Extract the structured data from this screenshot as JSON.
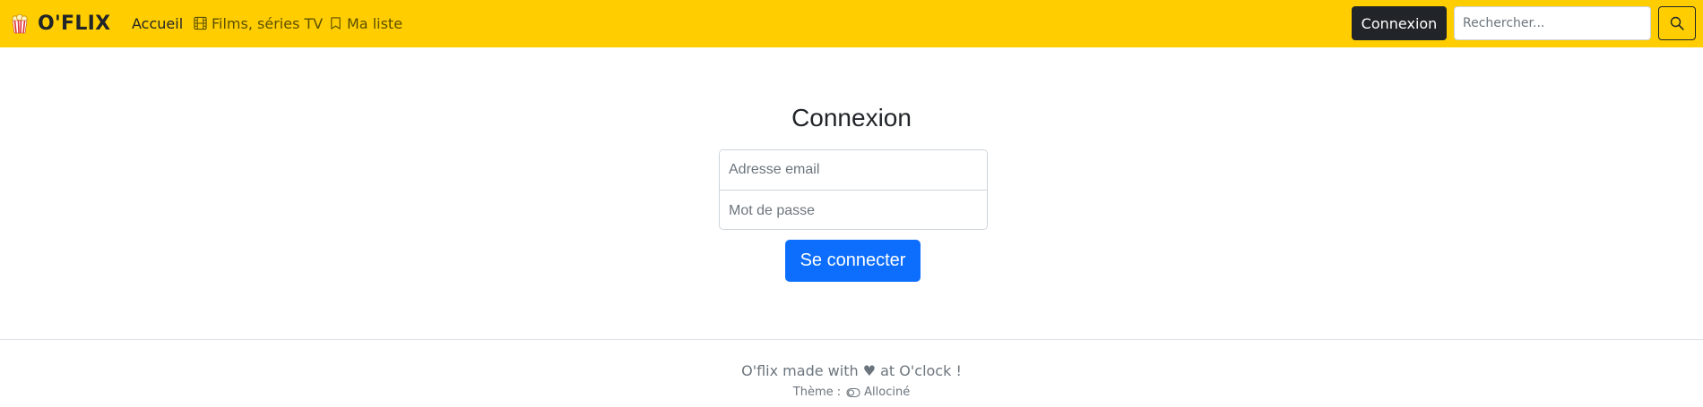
{
  "navbar": {
    "brand": "O'FLIX",
    "brand_icon": "popcorn-icon",
    "links": [
      {
        "label": "Accueil",
        "icon": null,
        "active": true
      },
      {
        "label": "Films, séries TV",
        "icon": "film-icon",
        "active": false
      },
      {
        "label": "Ma liste",
        "icon": "bookmark-icon",
        "active": false
      }
    ],
    "login_label": "Connexion",
    "search_placeholder": "Rechercher...",
    "search_value": "",
    "search_icon": "search-icon",
    "background_color": "#ffcd00"
  },
  "login": {
    "title": "Connexion",
    "email_placeholder": "Adresse email",
    "email_value": "",
    "password_placeholder": "Mot de passe",
    "password_value": "",
    "submit_label": "Se connecter",
    "submit_color": "#0d6efd"
  },
  "footer": {
    "credit": "O'flix made with ♥ at O'clock !",
    "theme_label": "Thème :",
    "theme_icon": "toggle-icon",
    "theme_name": "Allociné"
  }
}
